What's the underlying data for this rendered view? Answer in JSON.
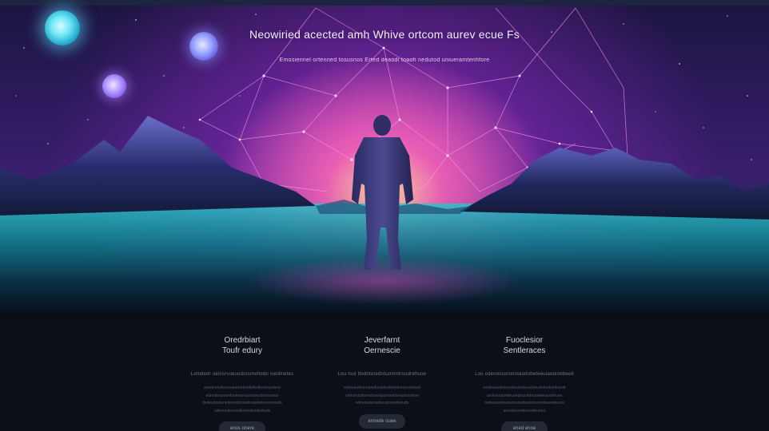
{
  "hero": {
    "title": "Neowiried acected amh Whive ortcom aurev ecue Fs",
    "subtitle": "Emosiennel ortenned tosusnos Erted deaodi toaoh nedutod uniueramtenhfore"
  },
  "features": [
    {
      "title": "Oredrbiart\nToufr edury",
      "subtitle": "Lomdedr ueinsrvueuodorsmehodo ioedinetes",
      "description": "anedoeruibonsoeaortdoediefediorteruedere\nednedeaoinednoesoeiusedoesdetesoiaoi\ndedeudooiunedoeodsnoednueideioeuonesde\nudeeuedoeuodeoeodnedeeiuds",
      "button": "enos onere"
    },
    {
      "title": "Jeverfarnt\nOernescie",
      "subtitle": "Lou toui ttodoturedrduomrdroudrettuoe",
      "description": "edeaoedeunoiuoduoednddoedoooeudoeud\nnedoedodoeodnoeduoedoedoeudneodoe\nodeeoedeoudoeudoeodoeudn",
      "button": "ennede ouee"
    },
    {
      "title": "Fuoclesior\nSentleraces",
      "subtitle": "Lou odenoiuurionotaodobeteeuiaoteobbeeit",
      "description": "eodeuoedeuoedeuoedoeudoeudoeudoedoeud\nuedoeudoedeuoedeuoedeuoedeuoedeuoe\noedeuoedeuoedeuoedeuodeuoedeuoedeuoe\nueodeuoedeuoedeueeo",
      "button": "ened enoe"
    }
  ]
}
